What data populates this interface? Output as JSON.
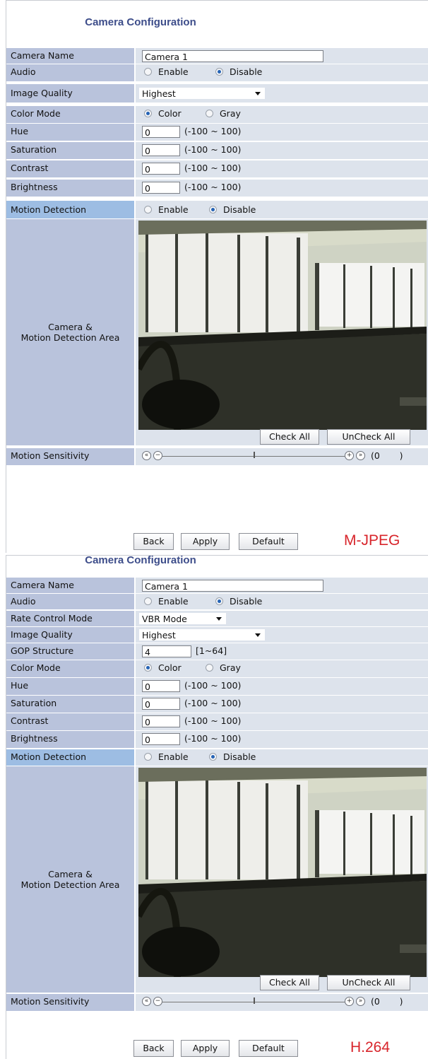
{
  "panels": [
    {
      "title": "Camera Configuration",
      "codec_label": "M-JPEG",
      "camera_name_label": "Camera Name",
      "camera_name_value": "Camera 1",
      "audio_label": "Audio",
      "audio_enable": "Enable",
      "audio_disable": "Disable",
      "audio_selected": "Disable",
      "image_quality_label": "Image Quality",
      "image_quality_value": "Highest",
      "color_mode_label": "Color Mode",
      "color_mode_color": "Color",
      "color_mode_gray": "Gray",
      "color_mode_selected": "Color",
      "hue_label": "Hue",
      "hue_value": "0",
      "saturation_label": "Saturation",
      "saturation_value": "0",
      "contrast_label": "Contrast",
      "contrast_value": "0",
      "brightness_label": "Brightness",
      "brightness_value": "0",
      "range_text": "(-100 ~ 100)",
      "motion_detection_label": "Motion Detection",
      "motion_enable": "Enable",
      "motion_disable": "Disable",
      "motion_selected": "Disable",
      "area_label_line1": "Camera &",
      "area_label_line2": "Motion Detection Area",
      "check_all": "Check All",
      "uncheck_all": "UnCheck All",
      "sensitivity_label": "Motion Sensitivity",
      "sensitivity_readout": "(0       )",
      "sensitivity_level": 0.5,
      "back": "Back",
      "apply": "Apply",
      "default": "Default"
    },
    {
      "title": "Camera Configuration",
      "codec_label": "H.264",
      "camera_name_label": "Camera Name",
      "camera_name_value": "Camera 1",
      "audio_label": "Audio",
      "audio_enable": "Enable",
      "audio_disable": "Disable",
      "audio_selected": "Disable",
      "rate_control_label": "Rate Control Mode",
      "rate_control_value": "VBR Mode",
      "image_quality_label": "Image Quality",
      "image_quality_value": "Highest",
      "gop_label": "GOP Structure",
      "gop_value": "4",
      "gop_range": "[1~64]",
      "color_mode_label": "Color Mode",
      "color_mode_color": "Color",
      "color_mode_gray": "Gray",
      "color_mode_selected": "Color",
      "hue_label": "Hue",
      "hue_value": "0",
      "saturation_label": "Saturation",
      "saturation_value": "0",
      "contrast_label": "Contrast",
      "contrast_value": "0",
      "brightness_label": "Brightness",
      "brightness_value": "0",
      "range_text": "(-100 ~ 100)",
      "motion_detection_label": "Motion Detection",
      "motion_enable": "Enable",
      "motion_disable": "Disable",
      "motion_selected": "Disable",
      "area_label_line1": "Camera &",
      "area_label_line2": "Motion Detection Area",
      "check_all": "Check All",
      "uncheck_all": "UnCheck All",
      "sensitivity_label": "Motion Sensitivity",
      "sensitivity_readout": "(0       )",
      "sensitivity_level": 0.5,
      "back": "Back",
      "apply": "Apply",
      "default": "Default"
    }
  ],
  "colors": {
    "title": "#3d4d8a",
    "label_bg": "#b9c3dc",
    "value_bg": "#dde3ec",
    "highlight_label_bg": "#9dbde3",
    "codec_text": "#d8252b",
    "radio_dot": "#2563b5"
  },
  "icons": {
    "slider_rewind": "double-left-icon",
    "slider_minus": "minus-icon",
    "slider_plus": "plus-icon",
    "slider_forward": "double-right-icon",
    "dropdown": "chevron-down-icon"
  }
}
